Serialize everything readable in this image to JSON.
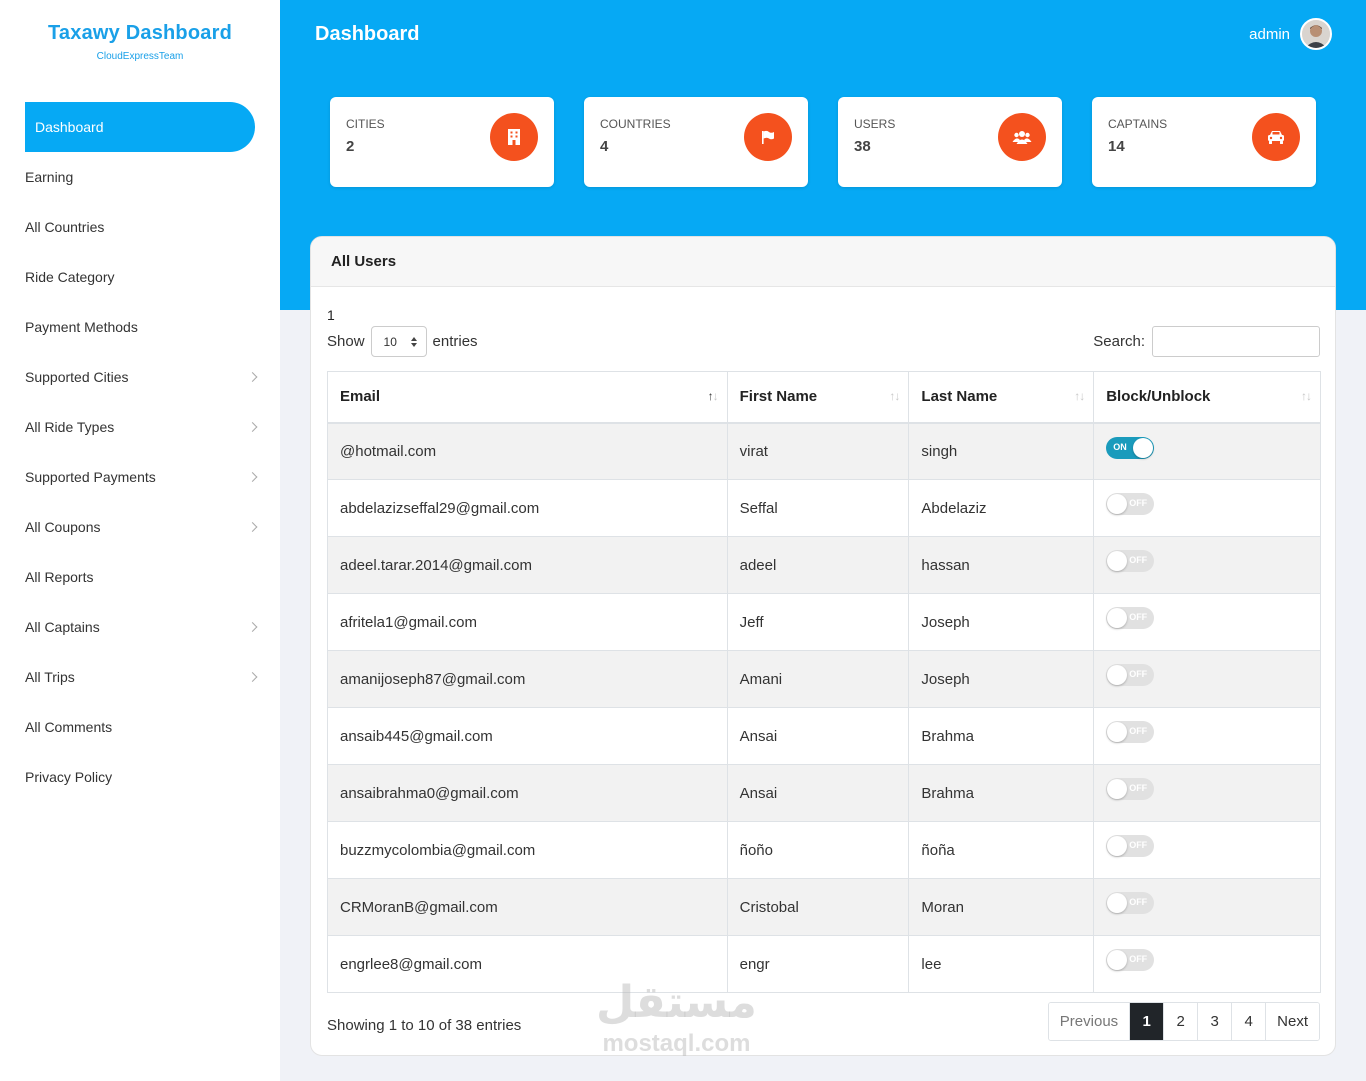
{
  "brand": {
    "title": "Taxawy Dashboard",
    "subtitle": "CloudExpressTeam"
  },
  "sidebar": {
    "items": [
      {
        "label": "Dashboard",
        "active": true,
        "has_children": false
      },
      {
        "label": "Earning",
        "has_children": false
      },
      {
        "label": "All Countries",
        "has_children": false
      },
      {
        "label": "Ride Category",
        "has_children": false
      },
      {
        "label": "Payment Methods",
        "has_children": false
      },
      {
        "label": "Supported Cities",
        "has_children": true
      },
      {
        "label": "All Ride Types",
        "has_children": true
      },
      {
        "label": "Supported Payments",
        "has_children": true
      },
      {
        "label": "All Coupons",
        "has_children": true
      },
      {
        "label": "All Reports",
        "has_children": false
      },
      {
        "label": "All Captains",
        "has_children": true
      },
      {
        "label": "All Trips",
        "has_children": true
      },
      {
        "label": "All Comments",
        "has_children": false
      },
      {
        "label": "Privacy Policy",
        "has_children": false
      }
    ]
  },
  "header": {
    "title": "Dashboard",
    "user": "admin"
  },
  "stats": [
    {
      "label": "CITIES",
      "value": "2",
      "icon": "building-icon"
    },
    {
      "label": "COUNTRIES",
      "value": "4",
      "icon": "flag-icon"
    },
    {
      "label": "USERS",
      "value": "38",
      "icon": "users-icon"
    },
    {
      "label": "CAPTAINS",
      "value": "14",
      "icon": "car-icon"
    }
  ],
  "users_panel": {
    "title": "All Users",
    "page_marker": "1",
    "show_label": "Show",
    "entries_label": "entries",
    "page_size": "10",
    "search_label": "Search:",
    "search_value": "",
    "columns": [
      "Email",
      "First Name",
      "Last Name",
      "Block/Unblock"
    ],
    "rows": [
      {
        "email": "@hotmail.com",
        "first": "virat",
        "last": "singh",
        "blocked": true
      },
      {
        "email": "abdelazizseffal29@gmail.com",
        "first": "Seffal",
        "last": "Abdelaziz",
        "blocked": false
      },
      {
        "email": "adeel.tarar.2014@gmail.com",
        "first": "adeel",
        "last": "hassan",
        "blocked": false
      },
      {
        "email": "afritela1@gmail.com",
        "first": "Jeff",
        "last": "Joseph",
        "blocked": false
      },
      {
        "email": "amanijoseph87@gmail.com",
        "first": "Amani",
        "last": "Joseph",
        "blocked": false
      },
      {
        "email": "ansaib445@gmail.com",
        "first": "Ansai",
        "last": "Brahma",
        "blocked": false
      },
      {
        "email": "ansaibrahma0@gmail.com",
        "first": "Ansai",
        "last": "Brahma",
        "blocked": false
      },
      {
        "email": "buzzmycolombia@gmail.com",
        "first": "ñoño",
        "last": "ñoña",
        "blocked": false
      },
      {
        "email": "CRMoranB@gmail.com",
        "first": "Cristobal",
        "last": "Moran",
        "blocked": false
      },
      {
        "email": "engrlee8@gmail.com",
        "first": "engr",
        "last": "lee",
        "blocked": false
      }
    ],
    "toggle_on": "ON",
    "toggle_off": "OFF",
    "info": "Showing 1 to 10 of 38 entries",
    "pagination": {
      "previous": "Previous",
      "pages": [
        "1",
        "2",
        "3",
        "4"
      ],
      "current": "1",
      "next": "Next"
    }
  },
  "watermark": {
    "arabic": "مستقل",
    "latin": "mostaql.com"
  },
  "colors": {
    "primary": "#06a9f4",
    "accent": "#f4511e",
    "brand": "#1aa0e8",
    "toggle_on": "#1a9bbc"
  }
}
